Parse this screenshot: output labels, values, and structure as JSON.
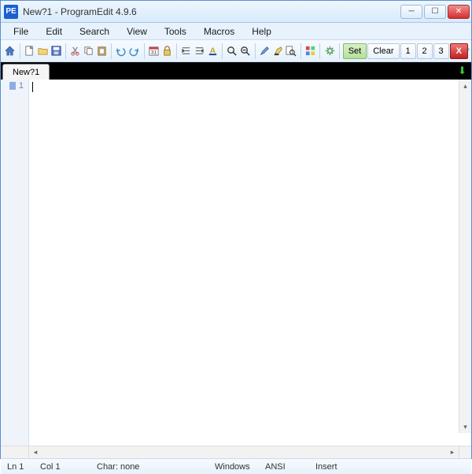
{
  "titlebar": {
    "app_icon_text": "PE",
    "title": "New?1  -  ProgramEdit 4.9.6"
  },
  "menu": {
    "items": [
      "File",
      "Edit",
      "Search",
      "View",
      "Tools",
      "Macros",
      "Help"
    ]
  },
  "toolbar": {
    "set_label": "Set",
    "clear_label": "Clear",
    "num1": "1",
    "num2": "2",
    "num3": "3",
    "x_label": "X"
  },
  "tabs": {
    "active": "New?1"
  },
  "editor": {
    "line_number": "1",
    "content": ""
  },
  "status": {
    "ln": "Ln 1",
    "col": "Col 1",
    "char": "Char: none",
    "os": "Windows",
    "enc": "ANSI",
    "mode": "Insert"
  }
}
